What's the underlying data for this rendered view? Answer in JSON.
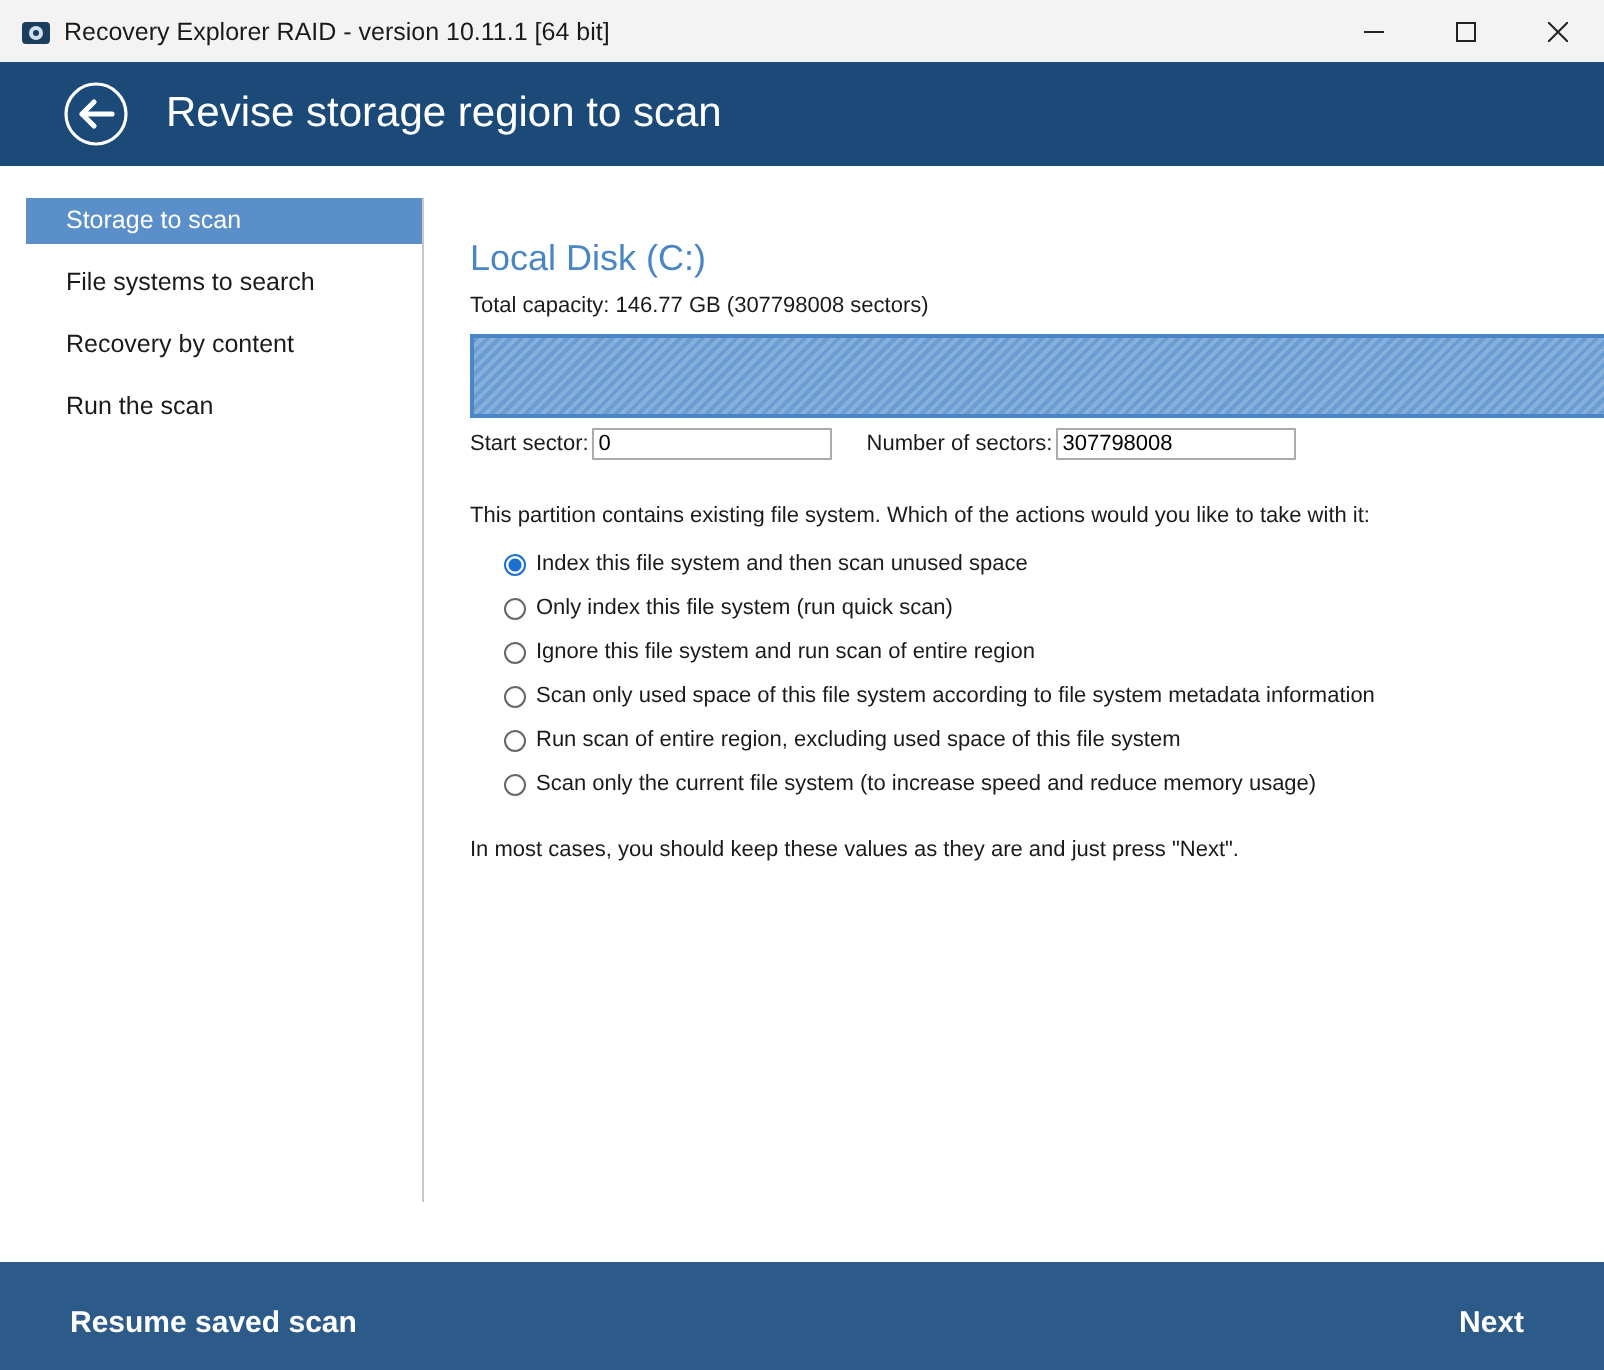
{
  "window": {
    "title": "Recovery Explorer RAID - version 10.11.1 [64 bit]"
  },
  "header": {
    "title": "Revise storage region to scan"
  },
  "sidebar": {
    "items": [
      {
        "label": "Storage to scan",
        "selected": true
      },
      {
        "label": "File systems to search",
        "selected": false
      },
      {
        "label": "Recovery by content",
        "selected": false
      },
      {
        "label": "Run the scan",
        "selected": false
      }
    ]
  },
  "main": {
    "disk_title": "Local Disk (C:)",
    "capacity": "Total capacity: 146.77 GB (307798008 sectors)",
    "fields": [
      {
        "label": "Start sector:",
        "value": "0"
      },
      {
        "label": "Number of sectors:",
        "value": "307798008"
      }
    ],
    "question": "This partition contains existing file system. Which of the actions would you like to take with it:",
    "options": [
      {
        "label": "Index this file system and then scan unused space",
        "selected": true
      },
      {
        "label": "Only index this file system (run quick scan)",
        "selected": false
      },
      {
        "label": "Ignore this file system and run scan of entire region",
        "selected": false
      },
      {
        "label": "Scan only used space of this file system according to file system metadata information",
        "selected": false
      },
      {
        "label": "Run scan of entire region, excluding used space of this file system",
        "selected": false
      },
      {
        "label": "Scan only the current file system (to increase speed and reduce memory usage)",
        "selected": false
      }
    ],
    "hint": "In most cases, you should keep these values as they are and just press \"Next\"."
  },
  "footer": {
    "left_button": "Resume saved scan",
    "right_button": "Next"
  }
}
